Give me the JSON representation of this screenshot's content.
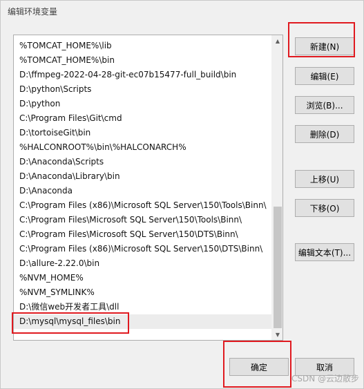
{
  "window": {
    "title": "编辑环境变量"
  },
  "path_list": {
    "items": [
      "%TOMCAT_HOME%\\lib",
      "%TOMCAT_HOME%\\bin",
      "D:\\ffmpeg-2022-04-28-git-ec07b15477-full_build\\bin",
      "D:\\python\\Scripts",
      "D:\\python",
      "C:\\Program Files\\Git\\cmd",
      "D:\\tortoiseGit\\bin",
      "%HALCONROOT%\\bin\\%HALCONARCH%",
      "D:\\Anaconda\\Scripts",
      "D:\\Anaconda\\Library\\bin",
      "D:\\Anaconda",
      "C:\\Program Files (x86)\\Microsoft SQL Server\\150\\Tools\\Binn\\",
      "C:\\Program Files\\Microsoft SQL Server\\150\\Tools\\Binn\\",
      "C:\\Program Files\\Microsoft SQL Server\\150\\DTS\\Binn\\",
      "C:\\Program Files (x86)\\Microsoft SQL Server\\150\\DTS\\Binn\\",
      "D:\\allure-2.22.0\\bin",
      "%NVM_HOME%",
      "%NVM_SYMLINK%",
      "D:\\微信web开发者工具\\dll",
      "D:\\mysql\\mysql_files\\bin"
    ],
    "selected_item": "D:\\mysql\\mysql_files\\bin"
  },
  "buttons": {
    "new": "新建(N)",
    "edit": "编辑(E)",
    "browse": "浏览(B)...",
    "delete": "删除(D)",
    "move_up": "上移(U)",
    "move_down": "下移(O)",
    "edit_text": "编辑文本(T)...",
    "ok": "确定",
    "cancel": "取消"
  },
  "annotation": {
    "color": "#e0191f"
  },
  "watermark": "CSDN @云边散步"
}
